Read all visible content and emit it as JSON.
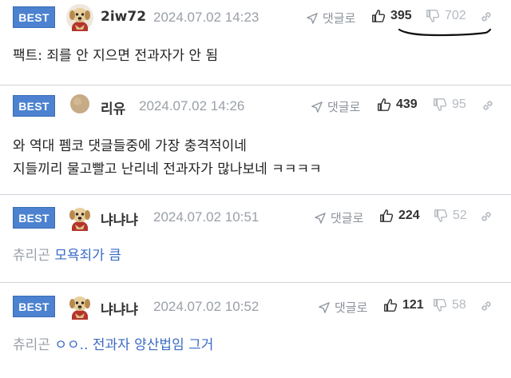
{
  "comments": [
    {
      "badge": "BEST",
      "nickname": "2iw72",
      "datetime": "2024.07.02 14:23",
      "reply_label": "댓글로",
      "upvotes": "395",
      "downvotes": "702",
      "body_lines": [
        "팩트: 죄를 안 지으면 전과자가 안 됨"
      ]
    },
    {
      "badge": "BEST",
      "nickname": "리유",
      "datetime": "2024.07.02 14:26",
      "reply_label": "댓글로",
      "upvotes": "439",
      "downvotes": "95",
      "body_lines": [
        "와 역대 펨코 댓글들중에 가장 충격적이네",
        "지들끼리 물고빨고 난리네 전과자가 많나보네 ㅋㅋㅋㅋ"
      ]
    },
    {
      "badge": "BEST",
      "nickname": "냐냐냐",
      "datetime": "2024.07.02 10:51",
      "reply_label": "댓글로",
      "upvotes": "224",
      "downvotes": "52",
      "reply_target": "츄리곤",
      "reply_content": "모욕죄가 큼"
    },
    {
      "badge": "BEST",
      "nickname": "냐냐냐",
      "datetime": "2024.07.02 10:52",
      "reply_label": "댓글로",
      "upvotes": "121",
      "downvotes": "58",
      "reply_target": "츄리곤",
      "reply_content": "ㅇㅇ.. 전과자 양산법임 그거"
    }
  ],
  "colors": {
    "best_badge": "#4c82d0",
    "reply_link": "#3a6bc4",
    "muted": "#9aa0a8"
  },
  "icons": {
    "reply": "reply-arrow-icon",
    "upvote": "thumbs-up-icon",
    "downvote": "thumbs-down-icon",
    "link": "link-icon",
    "avatar": "puppy-avatar-icon"
  }
}
